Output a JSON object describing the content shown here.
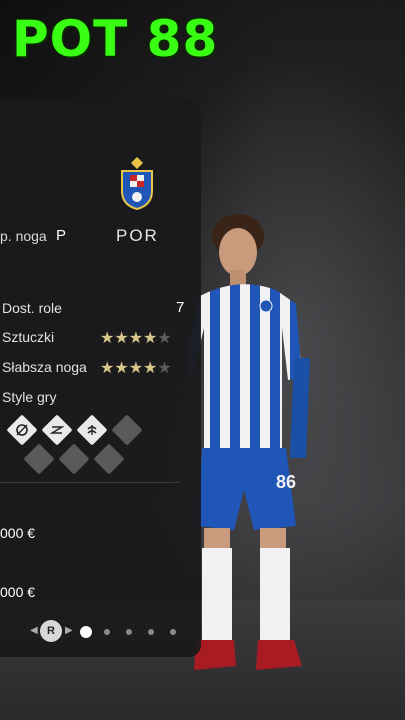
{
  "headline": "POT 88",
  "club": {
    "code": "POR",
    "logo_icon": "fc-porto-crest-icon"
  },
  "foot": {
    "label": "p. noga",
    "value": "P"
  },
  "stats": [
    {
      "label": "Dost. role",
      "value": "7"
    },
    {
      "label": "Sztuczki",
      "stars": 4,
      "max": 5
    },
    {
      "label": "Słabsza noga",
      "stars": 4,
      "max": 5
    }
  ],
  "playstyles": {
    "label": "Style gry",
    "icons": [
      "finesse-shot-icon",
      "trickster-icon",
      "first-touch-icon",
      "empty-slot",
      "empty-slot",
      "empty-slot",
      "empty-slot"
    ]
  },
  "finance": {
    "value_1": "000 €",
    "value_2": "000 €"
  },
  "pager": {
    "button": "R",
    "pages": 5,
    "active": 1
  },
  "colors": {
    "headline": "#39ff14",
    "star_on": "#d8c78a",
    "kit_blue": "#1f56b8",
    "panel": "#1a1a1c"
  }
}
